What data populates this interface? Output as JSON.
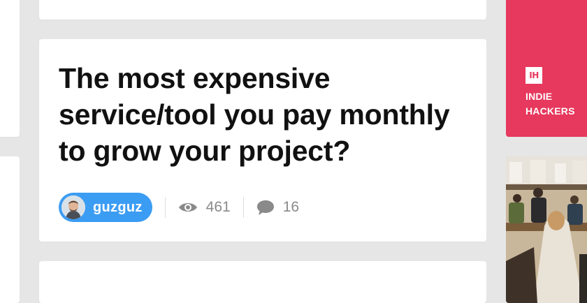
{
  "post": {
    "title": "The most expensive service/tool you pay monthly to grow your project?",
    "author": "guzguz",
    "views": "461",
    "comments": "16"
  },
  "icons": {
    "views": "eye-icon",
    "comments": "speech-bubble-icon",
    "brand": "indie-hackers-logo"
  },
  "sidebar": {
    "logo_text": "IH",
    "brand_line1": "INDIE",
    "brand_line2": "HACKERS"
  },
  "colors": {
    "author_pill": "#3b9cf3",
    "brand_tile": "#e7385d",
    "background": "#e6e6e6",
    "meta_text": "#8a8a8a"
  }
}
